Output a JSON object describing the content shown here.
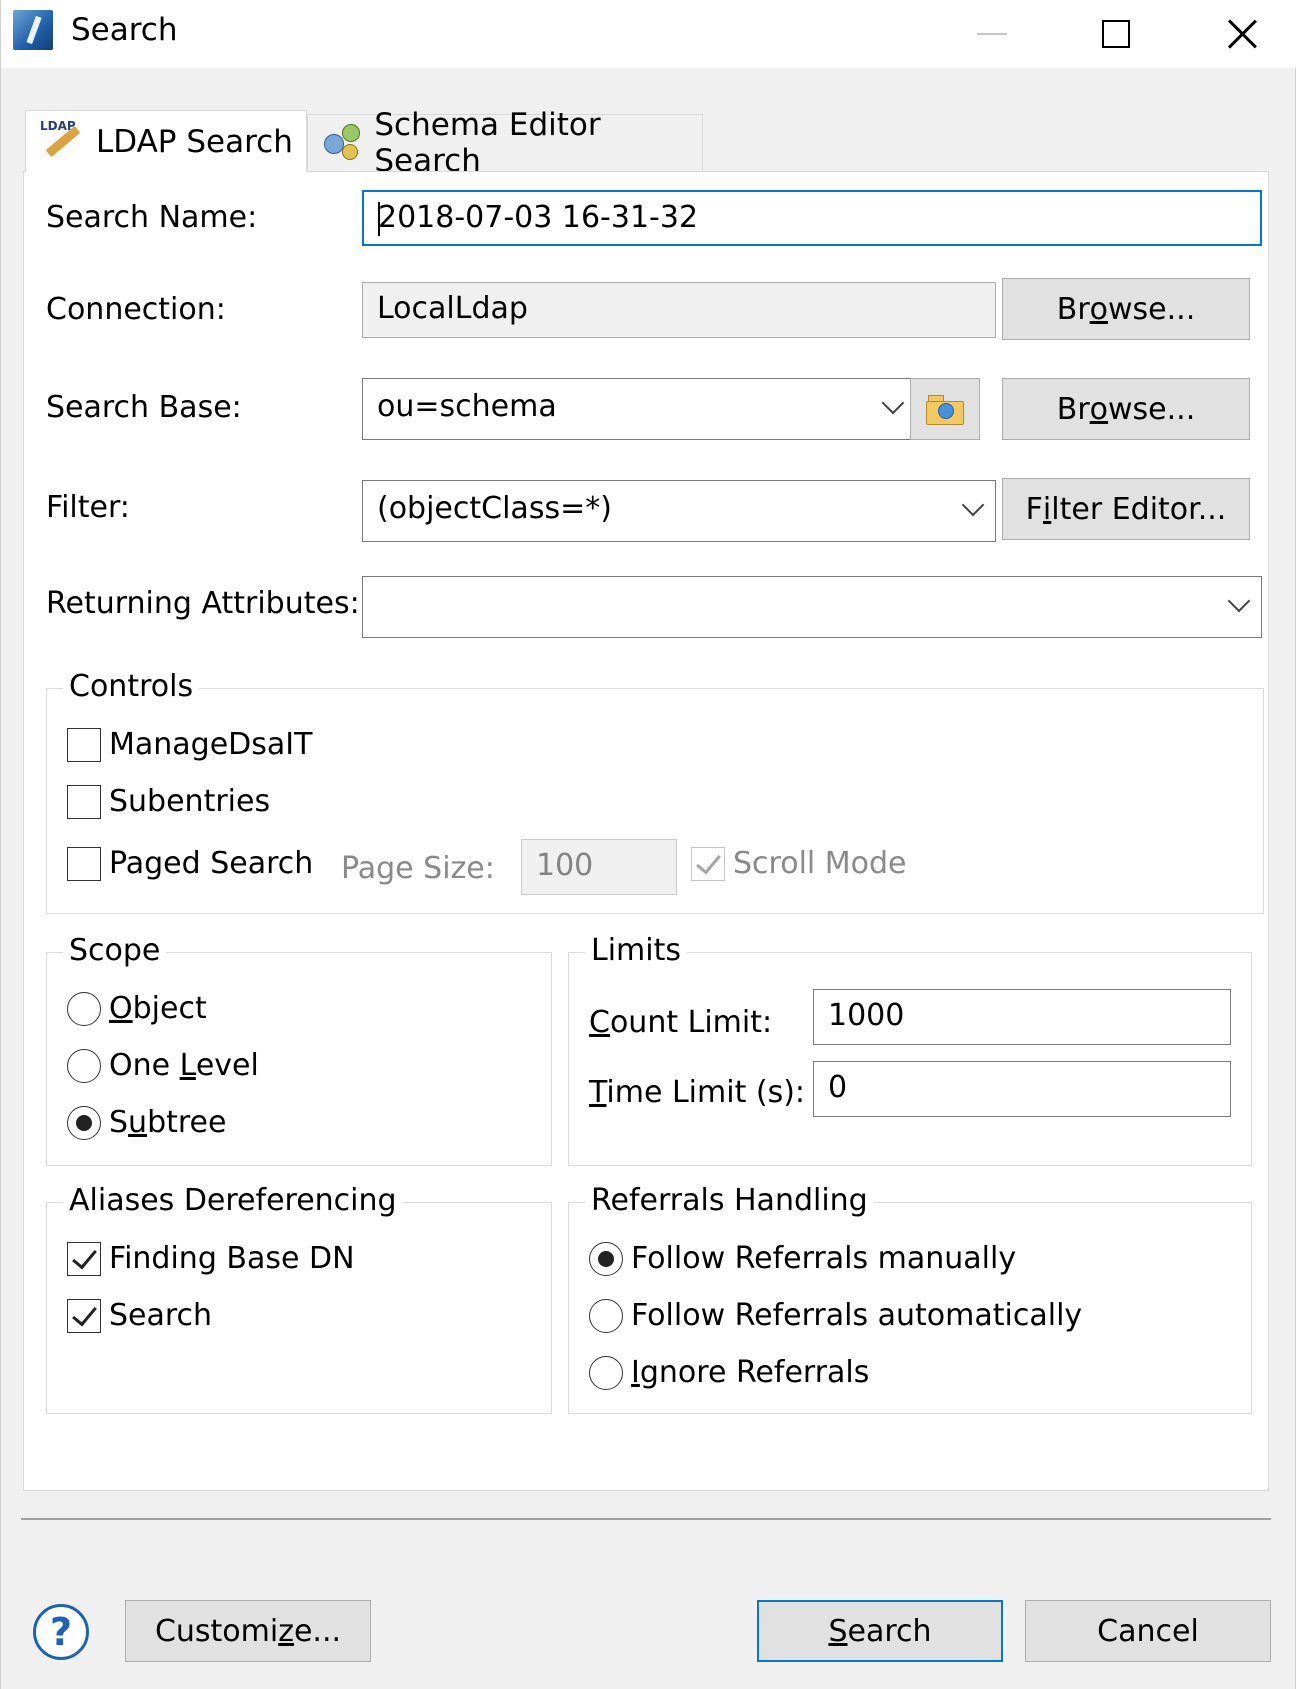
{
  "window": {
    "title": "Search",
    "controls": [
      "minimize-icon",
      "maximize-icon",
      "close-icon"
    ]
  },
  "tabs": [
    {
      "label": "LDAP Search",
      "icon": "ldap-search-icon",
      "active": true
    },
    {
      "label": "Schema Editor Search",
      "icon": "schema-editor-icon",
      "active": false
    }
  ],
  "form": {
    "search_name": {
      "label": "Search Name:",
      "value": "2018-07-03 16-31-32"
    },
    "connection": {
      "label": "Connection:",
      "value": "LocalLdap",
      "browse_pre": "Br",
      "browse_key": "o",
      "browse_post": "wse..."
    },
    "search_base": {
      "label": "Search Base:",
      "value": "ou=schema",
      "browse_pre": "Br",
      "browse_key": "o",
      "browse_post": "wse..."
    },
    "filter": {
      "label": "Filter:",
      "value": "(objectClass=*)",
      "editor_pre": "F",
      "editor_key": "i",
      "editor_post": "lter Editor..."
    },
    "returning_attributes": {
      "label": "Returning Attributes:",
      "value": ""
    }
  },
  "controls_group": {
    "title": "Controls",
    "manage_dsait": {
      "label": "ManageDsaIT",
      "checked": false
    },
    "subentries": {
      "label": "Subentries",
      "checked": false
    },
    "paged_search": {
      "label": "Paged Search",
      "checked": false
    },
    "page_size_label": "Page Size:",
    "page_size_value": "100",
    "scroll_mode": {
      "label": "Scroll Mode",
      "checked": true
    }
  },
  "scope": {
    "title": "Scope",
    "object": {
      "key": "O",
      "rest": "bject"
    },
    "one_level": {
      "pre": "One ",
      "key": "L",
      "rest": "evel"
    },
    "subtree": {
      "pre": "S",
      "key": "u",
      "rest": "btree"
    },
    "selected": "Subtree"
  },
  "limits": {
    "title": "Limits",
    "count_label_key": "C",
    "count_label_rest": "ount Limit:",
    "count_value": "1000",
    "time_label_key": "T",
    "time_label_rest": "ime Limit (s):",
    "time_value": "0"
  },
  "aliases": {
    "title": "Aliases Dereferencing",
    "finding_base_dn": {
      "label": "Finding Base DN",
      "checked": true
    },
    "search": {
      "label": "Search",
      "checked": true
    }
  },
  "referrals": {
    "title": "Referrals Handling",
    "manual": "Follow Referrals manually",
    "automatic": "Follow Referrals automatically",
    "ignore_key": "I",
    "ignore_rest": "gnore Referrals",
    "selected": "Follow Referrals manually"
  },
  "footer": {
    "customize_pre": "Customi",
    "customize_key": "z",
    "customize_post": "e...",
    "search_key": "S",
    "search_rest": "earch",
    "cancel": "Cancel"
  }
}
